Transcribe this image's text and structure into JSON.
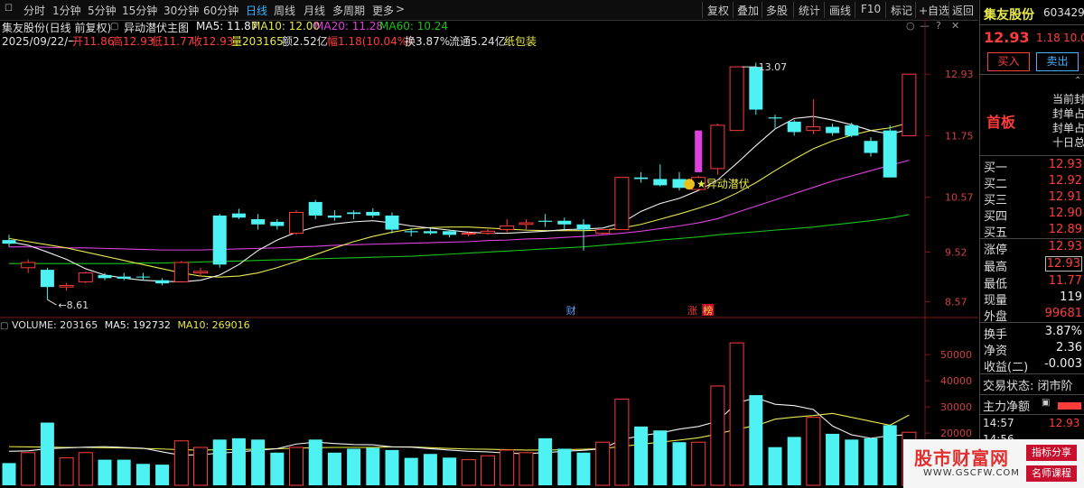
{
  "toolbar": {
    "timeframes": [
      "分时",
      "1分钟",
      "5分钟",
      "15分钟",
      "30分钟",
      "60分钟",
      "日线",
      "周线",
      "月线",
      "多周期",
      "更多"
    ],
    "active": "日线",
    "right_buttons": [
      "复权",
      "叠加",
      "多股",
      "统计",
      "画线",
      "F10",
      "标记",
      "+自选",
      "返回"
    ]
  },
  "info": {
    "title": "集友股份(日线 前复权)",
    "indicator": "异动潜伏主图",
    "ma5": "MA5: 11.87",
    "ma10": "MA10: 12.00",
    "ma20": "MA20: 11.28",
    "ma60": "MA60: 10.24",
    "date": "2025/09/22/一",
    "open": "开11.86",
    "high": "高12.93",
    "low": "低11.77",
    "close": "收12.93",
    "volume": "量203165",
    "amount": "额2.52亿",
    "change": "幅1.18(10.04%)",
    "turnover": "换3.87%",
    "float": "流通5.24亿",
    "tag": "纸包装"
  },
  "annotations": {
    "high_label": "13.07",
    "low_label": "8.61",
    "signal": "异动潜伏",
    "marker_cai": "财",
    "marker_zhang": "涨",
    "marker_bang": "榜"
  },
  "volume_header": {
    "volume": "VOLUME: 203165",
    "ma5": "MA5: 192732",
    "ma10": "MA10: 269016"
  },
  "colors": {
    "up": "#ff3c3c",
    "down": "#4ef2f2",
    "ma5": "#f0f0f0",
    "ma10": "#e8e84a",
    "ma20": "#e040e0",
    "ma60": "#19c219",
    "signal_bar": "#e040e0"
  },
  "right_panel": {
    "name": "集友股份",
    "code": "603429",
    "price": "12.93",
    "change": "1.18",
    "pct": "10.0",
    "buy_btn": "买入",
    "sell_btn": "卖出",
    "head_label": "首板",
    "seal_lines": [
      "当前封",
      "封单占",
      "封单占",
      "十日总"
    ],
    "bids": [
      {
        "label": "买一",
        "price": "12.93"
      },
      {
        "label": "买二",
        "price": "12.92"
      },
      {
        "label": "买三",
        "price": "12.91"
      },
      {
        "label": "买四",
        "price": "12.90"
      },
      {
        "label": "买五",
        "price": "12.89"
      }
    ],
    "stats1": [
      {
        "label": "涨停",
        "value": "12.93"
      },
      {
        "label": "最高",
        "value": "12.93"
      },
      {
        "label": "最低",
        "value": "11.77"
      },
      {
        "label": "现量",
        "value": "119"
      },
      {
        "label": "外盘",
        "value": "99681"
      }
    ],
    "stats2": [
      {
        "label": "换手",
        "value": "3.87%"
      },
      {
        "label": "净资",
        "value": "2.36"
      },
      {
        "label": "收益(二)",
        "value": "-0.003"
      }
    ],
    "trade_status": "交易状态: 闭市阶",
    "main_net": "主力净额",
    "tick_time": "14:57",
    "tick_price": "12.93",
    "tick_time2": "14:56"
  },
  "watermark": {
    "site": "股市财富网",
    "tag1": "指标分享",
    "url": "WWW.GSCFW.COM",
    "tag2": "名师课程"
  },
  "chart_data": {
    "type": "candlestick",
    "price_axis": {
      "ticks": [
        12.93,
        11.75,
        10.57,
        9.52,
        8.57
      ],
      "ylim": [
        8.3,
        13.4
      ]
    },
    "volume_axis": {
      "ticks": [
        50000,
        40000,
        30000,
        20000,
        10000
      ],
      "ylim": [
        0,
        58000
      ]
    },
    "candles": [
      {
        "o": 9.75,
        "h": 9.85,
        "l": 9.62,
        "c": 9.68,
        "v": 8500
      },
      {
        "o": 9.22,
        "h": 9.38,
        "l": 9.12,
        "c": 9.32,
        "v": 12500
      },
      {
        "o": 9.18,
        "h": 9.22,
        "l": 8.61,
        "c": 8.85,
        "v": 24000
      },
      {
        "o": 8.85,
        "h": 8.92,
        "l": 8.78,
        "c": 8.88,
        "v": 10500
      },
      {
        "o": 8.95,
        "h": 9.15,
        "l": 8.92,
        "c": 9.12,
        "v": 12500
      },
      {
        "o": 9.08,
        "h": 9.12,
        "l": 8.98,
        "c": 9.02,
        "v": 9800
      },
      {
        "o": 9.05,
        "h": 9.12,
        "l": 8.98,
        "c": 9.01,
        "v": 9800
      },
      {
        "o": 9.05,
        "h": 9.12,
        "l": 8.98,
        "c": 9.04,
        "v": 8200
      },
      {
        "o": 8.98,
        "h": 9.02,
        "l": 8.88,
        "c": 8.92,
        "v": 7900
      },
      {
        "o": 8.95,
        "h": 9.35,
        "l": 8.95,
        "c": 9.32,
        "v": 17000
      },
      {
        "o": 9.12,
        "h": 9.22,
        "l": 9.05,
        "c": 9.15,
        "v": 14500
      },
      {
        "o": 10.22,
        "h": 10.25,
        "l": 9.22,
        "c": 9.28,
        "v": 17500
      },
      {
        "o": 10.26,
        "h": 10.35,
        "l": 10.15,
        "c": 10.18,
        "v": 18000
      },
      {
        "o": 10.15,
        "h": 10.25,
        "l": 9.95,
        "c": 10.05,
        "v": 17500
      },
      {
        "o": 10.1,
        "h": 10.15,
        "l": 9.95,
        "c": 10.02,
        "v": 12500
      },
      {
        "o": 9.88,
        "h": 10.32,
        "l": 9.85,
        "c": 10.28,
        "v": 14500
      },
      {
        "o": 10.48,
        "h": 10.52,
        "l": 10.15,
        "c": 10.22,
        "v": 17500
      },
      {
        "o": 10.22,
        "h": 10.32,
        "l": 10.12,
        "c": 10.18,
        "v": 12500
      },
      {
        "o": 10.28,
        "h": 10.32,
        "l": 10.15,
        "c": 10.25,
        "v": 14000
      },
      {
        "o": 10.29,
        "h": 10.36,
        "l": 10.18,
        "c": 10.22,
        "v": 14300
      },
      {
        "o": 10.22,
        "h": 10.28,
        "l": 9.88,
        "c": 9.95,
        "v": 13500
      },
      {
        "o": 9.92,
        "h": 9.98,
        "l": 9.82,
        "c": 9.9,
        "v": 10500
      },
      {
        "o": 9.92,
        "h": 9.98,
        "l": 9.85,
        "c": 9.88,
        "v": 12000
      },
      {
        "o": 9.92,
        "h": 9.95,
        "l": 9.8,
        "c": 9.85,
        "v": 10600
      },
      {
        "o": 9.88,
        "h": 9.92,
        "l": 9.82,
        "c": 9.88,
        "v": 9800
      },
      {
        "o": 9.88,
        "h": 9.96,
        "l": 9.85,
        "c": 9.92,
        "v": 11300
      },
      {
        "o": 9.95,
        "h": 10.15,
        "l": 9.9,
        "c": 10.02,
        "v": 13500
      },
      {
        "o": 10.05,
        "h": 10.15,
        "l": 9.95,
        "c": 10.08,
        "v": 12500
      },
      {
        "o": 10.12,
        "h": 10.25,
        "l": 10.0,
        "c": 10.1,
        "v": 18000
      },
      {
        "o": 10.12,
        "h": 10.18,
        "l": 9.95,
        "c": 10.05,
        "v": 14000
      },
      {
        "o": 10.05,
        "h": 10.15,
        "l": 9.55,
        "c": 9.95,
        "v": 12500
      },
      {
        "o": 9.88,
        "h": 9.95,
        "l": 9.85,
        "c": 9.95,
        "v": 16500
      },
      {
        "o": 9.95,
        "h": 10.95,
        "l": 9.95,
        "c": 10.95,
        "v": 33000
      },
      {
        "o": 10.95,
        "h": 11.05,
        "l": 10.85,
        "c": 10.92,
        "v": 22500
      },
      {
        "o": 10.92,
        "h": 11.2,
        "l": 10.78,
        "c": 10.8,
        "v": 21000
      },
      {
        "o": 10.92,
        "h": 11.05,
        "l": 10.7,
        "c": 10.75,
        "v": 16500
      },
      {
        "o": 10.72,
        "h": 10.98,
        "l": 10.7,
        "c": 10.95,
        "v": 16500
      },
      {
        "o": 11.12,
        "h": 11.98,
        "l": 11.0,
        "c": 11.95,
        "v": 38000
      },
      {
        "o": 11.85,
        "h": 13.07,
        "l": 11.85,
        "c": 13.07,
        "v": 54500
      },
      {
        "o": 13.07,
        "h": 13.15,
        "l": 12.15,
        "c": 12.25,
        "v": 34500
      },
      {
        "o": 12.1,
        "h": 12.15,
        "l": 11.9,
        "c": 12.08,
        "v": 14600
      },
      {
        "o": 12.02,
        "h": 12.05,
        "l": 11.75,
        "c": 11.82,
        "v": 18500
      },
      {
        "o": 11.85,
        "h": 12.45,
        "l": 11.78,
        "c": 11.92,
        "v": 26000
      },
      {
        "o": 11.92,
        "h": 11.98,
        "l": 11.75,
        "c": 11.8,
        "v": 19700
      },
      {
        "o": 11.95,
        "h": 12.0,
        "l": 11.72,
        "c": 11.75,
        "v": 17500
      },
      {
        "o": 11.65,
        "h": 11.72,
        "l": 11.35,
        "c": 11.42,
        "v": 18000
      },
      {
        "o": 11.85,
        "h": 11.95,
        "l": 10.95,
        "c": 10.95,
        "v": 23000
      },
      {
        "o": 11.75,
        "h": 12.93,
        "l": 11.75,
        "c": 12.93,
        "v": 20300
      }
    ],
    "ma5": [
      9.72,
      9.65,
      9.52,
      9.38,
      9.2,
      9.08,
      9.02,
      8.98,
      8.96,
      8.95,
      8.98,
      9.08,
      9.28,
      9.55,
      9.75,
      9.9,
      10.0,
      10.06,
      10.1,
      10.12,
      10.08,
      10.02,
      9.98,
      9.94,
      9.9,
      9.88,
      9.88,
      9.9,
      9.92,
      9.95,
      9.96,
      9.98,
      10.08,
      10.3,
      10.45,
      10.55,
      10.7,
      10.9,
      11.22,
      11.56,
      11.88,
      12.08,
      12.12,
      12.05,
      11.96,
      11.85,
      11.78,
      11.87
    ],
    "ma10": [
      9.78,
      9.72,
      9.66,
      9.6,
      9.52,
      9.44,
      9.36,
      9.28,
      9.2,
      9.12,
      9.06,
      9.04,
      9.06,
      9.12,
      9.22,
      9.34,
      9.47,
      9.6,
      9.72,
      9.82,
      9.9,
      9.96,
      9.99,
      10.0,
      10.0,
      9.98,
      9.96,
      9.94,
      9.93,
      9.93,
      9.93,
      9.94,
      9.98,
      10.05,
      10.15,
      10.25,
      10.36,
      10.48,
      10.65,
      10.85,
      11.08,
      11.3,
      11.5,
      11.65,
      11.76,
      11.85,
      11.9,
      12.0
    ],
    "ma20": [
      9.62,
      9.62,
      9.61,
      9.6,
      9.6,
      9.59,
      9.58,
      9.57,
      9.56,
      9.56,
      9.56,
      9.57,
      9.58,
      9.59,
      9.6,
      9.62,
      9.63,
      9.65,
      9.66,
      9.67,
      9.68,
      9.69,
      9.7,
      9.71,
      9.72,
      9.74,
      9.75,
      9.77,
      9.78,
      9.8,
      9.82,
      9.85,
      9.88,
      9.92,
      9.97,
      10.02,
      10.08,
      10.16,
      10.28,
      10.4,
      10.52,
      10.64,
      10.76,
      10.88,
      10.98,
      11.08,
      11.18,
      11.28
    ],
    "ma60": [
      9.3,
      9.3,
      9.3,
      9.3,
      9.3,
      9.3,
      9.3,
      9.31,
      9.31,
      9.32,
      9.33,
      9.34,
      9.35,
      9.36,
      9.37,
      9.38,
      9.39,
      9.4,
      9.41,
      9.42,
      9.43,
      9.44,
      9.46,
      9.48,
      9.5,
      9.52,
      9.54,
      9.56,
      9.58,
      9.6,
      9.62,
      9.65,
      9.68,
      9.71,
      9.75,
      9.78,
      9.81,
      9.85,
      9.88,
      9.91,
      9.94,
      9.97,
      10.0,
      10.04,
      10.08,
      10.12,
      10.17,
      10.24
    ],
    "vol_ma5": [
      13000,
      13200,
      14000,
      14300,
      14600,
      14800,
      14500,
      14200,
      12800,
      11500,
      11700,
      12300,
      12800,
      13400,
      14000,
      15800,
      16500,
      16000,
      15600,
      15500,
      14700,
      14600,
      14000,
      13500,
      13000,
      12800,
      12300,
      12100,
      12500,
      13000,
      13400,
      14000,
      17500,
      19000,
      20000,
      21500,
      22500,
      24500,
      31500,
      33500,
      31000,
      30500,
      29000,
      22700,
      19300,
      18000,
      19000,
      19300
    ],
    "vol_ma10": [
      14800,
      14700,
      14600,
      14500,
      14500,
      14400,
      14300,
      14100,
      13900,
      13600,
      13500,
      13600,
      13700,
      13800,
      14000,
      14200,
      14400,
      14500,
      14500,
      14500,
      14700,
      14700,
      14400,
      14100,
      13900,
      13800,
      13600,
      13500,
      13500,
      13600,
      13800,
      14000,
      14900,
      15700,
      16500,
      17300,
      18200,
      19600,
      21500,
      22800,
      25300,
      26100,
      26700,
      27500,
      26000,
      24500,
      23000,
      26900
    ]
  }
}
